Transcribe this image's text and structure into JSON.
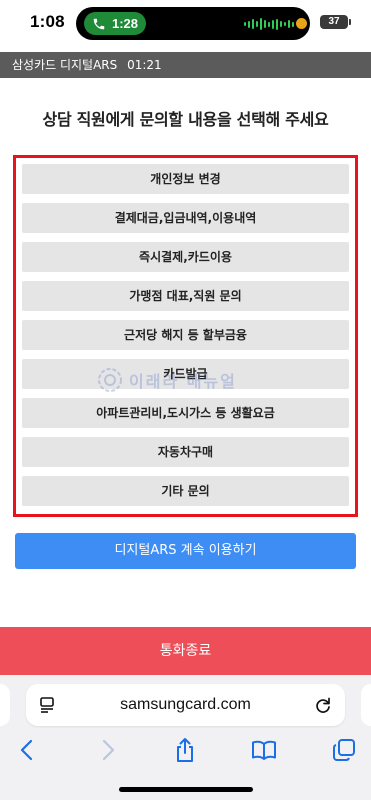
{
  "status_bar": {
    "time": "1:08",
    "call_time": "1:28",
    "battery": "37"
  },
  "ars_header": {
    "title": "삼성카드 디지털ARS",
    "timer": "01:21"
  },
  "page_title": "상담 직원에게 문의할 내용을 선택해 주세요",
  "options": [
    "개인정보 변경",
    "결제대금,입금내역,이용내역",
    "즉시결제,카드이용",
    "가맹점 대표,직원 문의",
    "근저당 해지 등 할부금융",
    "카드발급",
    "아파트관리비,도시가스 등 생활요금",
    "자동차구매",
    "기타 문의"
  ],
  "watermark": "이래라 매뉴얼",
  "continue_button": "디지털ARS 계속 이용하기",
  "end_call_button": "통화종료",
  "browser": {
    "url": "samsungcard.com"
  },
  "colors": {
    "highlight_border": "#e8141c",
    "primary": "#3d8df5",
    "end_call": "#ee4e57",
    "header": "#5b5b5b"
  }
}
